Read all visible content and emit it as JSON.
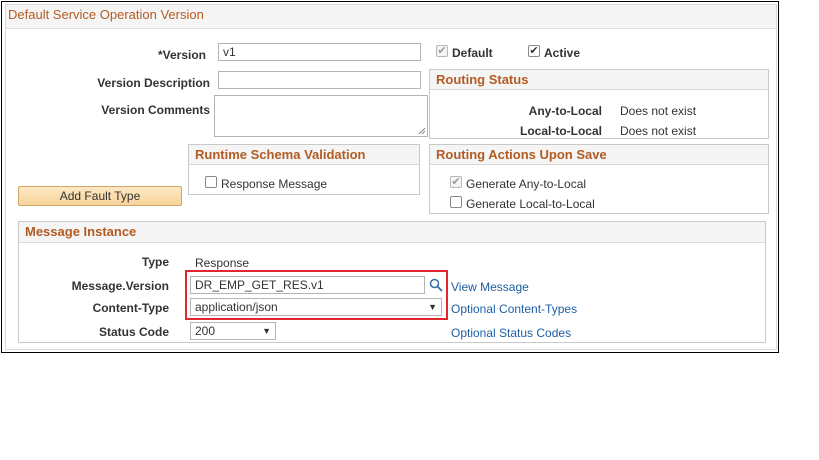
{
  "section_title": "Default Service Operation Version",
  "version": {
    "label": "*Version",
    "value": "v1",
    "default_label": "Default",
    "default_checked": true,
    "active_label": "Active",
    "active_checked": true
  },
  "version_description": {
    "label": "Version Description",
    "value": ""
  },
  "version_comments": {
    "label": "Version Comments",
    "value": ""
  },
  "routing_status": {
    "title": "Routing Status",
    "rows": [
      {
        "label": "Any-to-Local",
        "value": "Does not exist"
      },
      {
        "label": "Local-to-Local",
        "value": "Does not exist"
      }
    ]
  },
  "runtime_schema": {
    "title": "Runtime Schema Validation",
    "response_message_label": "Response Message",
    "response_message_checked": false
  },
  "routing_actions": {
    "title": "Routing Actions Upon Save",
    "generate_any_label": "Generate Any-to-Local",
    "generate_any_checked": true,
    "generate_local_label": "Generate Local-to-Local",
    "generate_local_checked": false
  },
  "add_fault_button": "Add Fault Type",
  "message_instance": {
    "title": "Message Instance",
    "type_label": "Type",
    "type_value": "Response",
    "message_version_label": "Message.Version",
    "message_version_value": "DR_EMP_GET_RES.v1",
    "view_message_link": "View Message",
    "content_type_label": "Content-Type",
    "content_type_value": "application/json",
    "optional_content_types_link": "Optional Content-Types",
    "status_code_label": "Status Code",
    "status_code_value": "200",
    "optional_status_codes_link": "Optional Status Codes"
  },
  "icons": {
    "search": "magnifier-icon",
    "dropdown": "triangle-down-icon",
    "checkmark": "✔"
  },
  "colors": {
    "section_title": "#b25b22",
    "link": "#1c5fa4",
    "highlight": "#e0262e",
    "button": "#f9d49b"
  }
}
